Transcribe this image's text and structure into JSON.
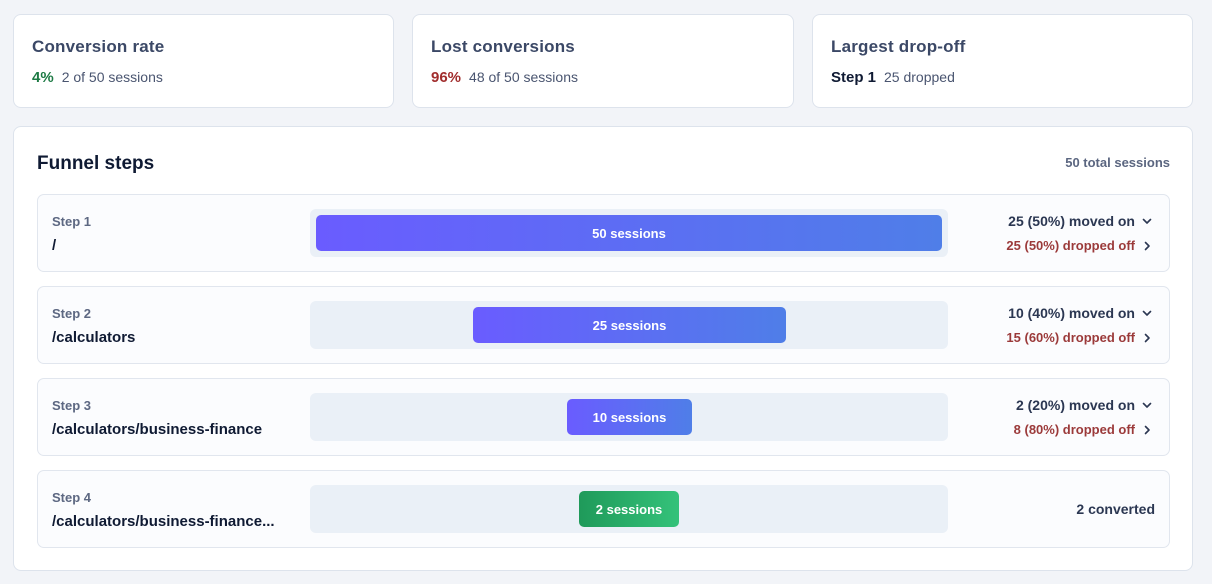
{
  "summary": {
    "conversion": {
      "title": "Conversion rate",
      "value": "4%",
      "detail": "2 of 50 sessions",
      "color": "#1d7a44"
    },
    "lost": {
      "title": "Lost conversions",
      "value": "96%",
      "detail": "48 of 50 sessions",
      "color": "#a12d2d"
    },
    "dropoff": {
      "title": "Largest drop-off",
      "value": "Step 1",
      "detail": "25 dropped",
      "color": "#0f1a33"
    }
  },
  "funnel": {
    "title": "Funnel steps",
    "total": "50 total sessions",
    "steps": [
      {
        "label": "Step 1",
        "path": "/",
        "sessions": "50 sessions",
        "count": 50,
        "moved": "25 (50%) moved on",
        "dropped": "25 (50%) dropped off"
      },
      {
        "label": "Step 2",
        "path": "/calculators",
        "sessions": "25 sessions",
        "count": 25,
        "moved": "10 (40%) moved on",
        "dropped": "15 (60%) dropped off"
      },
      {
        "label": "Step 3",
        "path": "/calculators/business-finance",
        "sessions": "10 sessions",
        "count": 10,
        "moved": "2 (20%) moved on",
        "dropped": "8 (80%) dropped off"
      },
      {
        "label": "Step 4",
        "path": "/calculators/business-finance...",
        "sessions": "2 sessions",
        "count": 2,
        "converted": "2 converted"
      }
    ]
  },
  "colors": {
    "bar_start": "#6a5cff",
    "bar_end": "#4f7ee8",
    "converted_start": "#1f9a5a",
    "converted_end": "#34c27a"
  }
}
